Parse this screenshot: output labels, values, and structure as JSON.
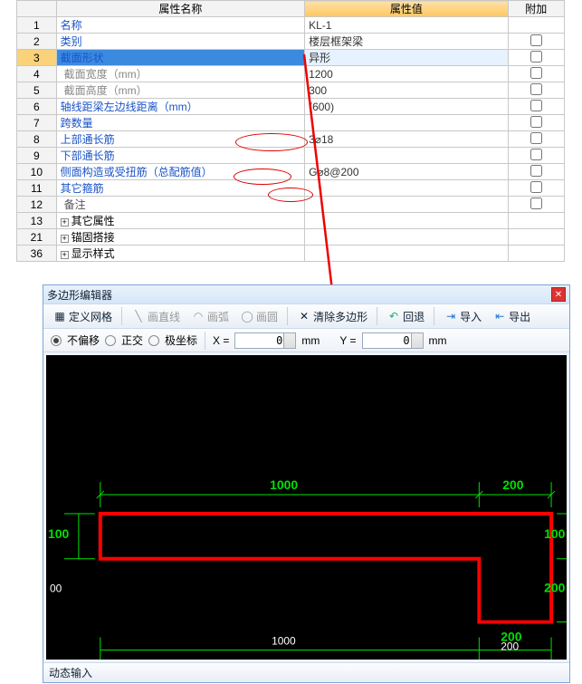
{
  "grid": {
    "headers": {
      "name": "属性名称",
      "value": "属性值",
      "extra": "附加"
    },
    "rows": [
      {
        "n": "1",
        "name": "名称",
        "val": "KL-1",
        "link": true,
        "cb": false
      },
      {
        "n": "2",
        "name": "类别",
        "val": "楼层框架梁",
        "link": true,
        "cb": true
      },
      {
        "n": "3",
        "name": "截面形状",
        "val": "异形",
        "link": true,
        "cb": true,
        "sel": true
      },
      {
        "n": "4",
        "name": "截面宽度（mm）",
        "val": "1200",
        "indent": true,
        "cb": true,
        "gray": true
      },
      {
        "n": "5",
        "name": "截面高度（mm）",
        "val": "300",
        "indent": true,
        "cb": true,
        "gray": true
      },
      {
        "n": "6",
        "name": "轴线距梁左边线距离（mm）",
        "val": "(600)",
        "link": true,
        "cb": true
      },
      {
        "n": "7",
        "name": "跨数量",
        "val": "",
        "link": true,
        "cb": true
      },
      {
        "n": "8",
        "name": "上部通长筋",
        "val": "3⌀18",
        "link": true,
        "cb": true
      },
      {
        "n": "9",
        "name": "下部通长筋",
        "val": "",
        "link": true,
        "cb": true
      },
      {
        "n": "10",
        "name": "侧面构造或受扭筋（总配筋值）",
        "val": "G⌀8@200",
        "link": true,
        "cb": true
      },
      {
        "n": "11",
        "name": "其它箍筋",
        "val": "",
        "link": true,
        "cb": true
      },
      {
        "n": "12",
        "name": "备注",
        "val": "",
        "indent": true,
        "cb": true
      },
      {
        "n": "13",
        "name": "其它属性",
        "val": "",
        "exp": true
      },
      {
        "n": "21",
        "name": "锚固搭接",
        "val": "",
        "exp": true
      },
      {
        "n": "36",
        "name": "显示样式",
        "val": "",
        "exp": true
      }
    ]
  },
  "editor": {
    "title": "多边形编辑器",
    "toolbar": {
      "definegrid": "定义网格",
      "line": "画直线",
      "arc": "画弧",
      "circle": "画圆",
      "clear": "清除多边形",
      "undo": "回退",
      "import": "导入",
      "export": "导出"
    },
    "coord": {
      "none": "不偏移",
      "ortho": "正交",
      "polar": "极坐标",
      "xlabel": "X =",
      "ylabel": "Y =",
      "x": "0",
      "y": "0",
      "unit": "mm"
    },
    "status": "动态输入",
    "dims": {
      "top1000": "1000",
      "top200": "200",
      "left100": "100",
      "right100": "100",
      "left_h": "00",
      "right200": "200",
      "bot1000": "1000",
      "bot200": "200"
    }
  }
}
